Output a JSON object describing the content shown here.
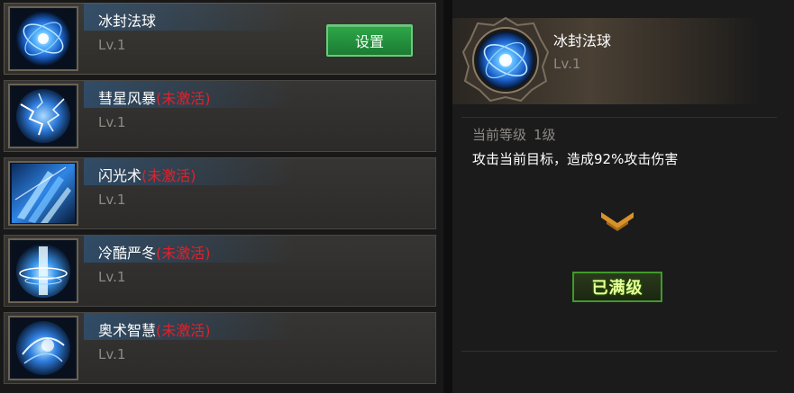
{
  "skills": [
    {
      "name": "冰封法球",
      "inactive_tag": "",
      "level": "Lv.1",
      "icon": "ice-orb-icon"
    },
    {
      "name": "彗星风暴",
      "inactive_tag": "(未激活)",
      "level": "Lv.1",
      "icon": "lightning-storm-icon"
    },
    {
      "name": "闪光术",
      "inactive_tag": "(未激活)",
      "level": "Lv.1",
      "icon": "ice-shard-icon"
    },
    {
      "name": "冷酷严冬",
      "inactive_tag": "(未激活)",
      "level": "Lv.1",
      "icon": "frost-pillar-icon"
    },
    {
      "name": "奥术智慧",
      "inactive_tag": "(未激活)",
      "level": "Lv.1",
      "icon": "arcane-orb-icon"
    }
  ],
  "set_button_label": "设置",
  "detail": {
    "name": "冰封法球",
    "level": "Lv.1",
    "current_level_label": "当前等级",
    "current_level_value": "1级",
    "description": "攻击当前目标，造成92%攻击伤害",
    "maxed_label": "已满级",
    "icon": "ice-orb-icon"
  },
  "colors": {
    "inactive_text": "#e0222a",
    "button_green": "#2fa84a",
    "maxed_text": "#e9ff9a"
  }
}
